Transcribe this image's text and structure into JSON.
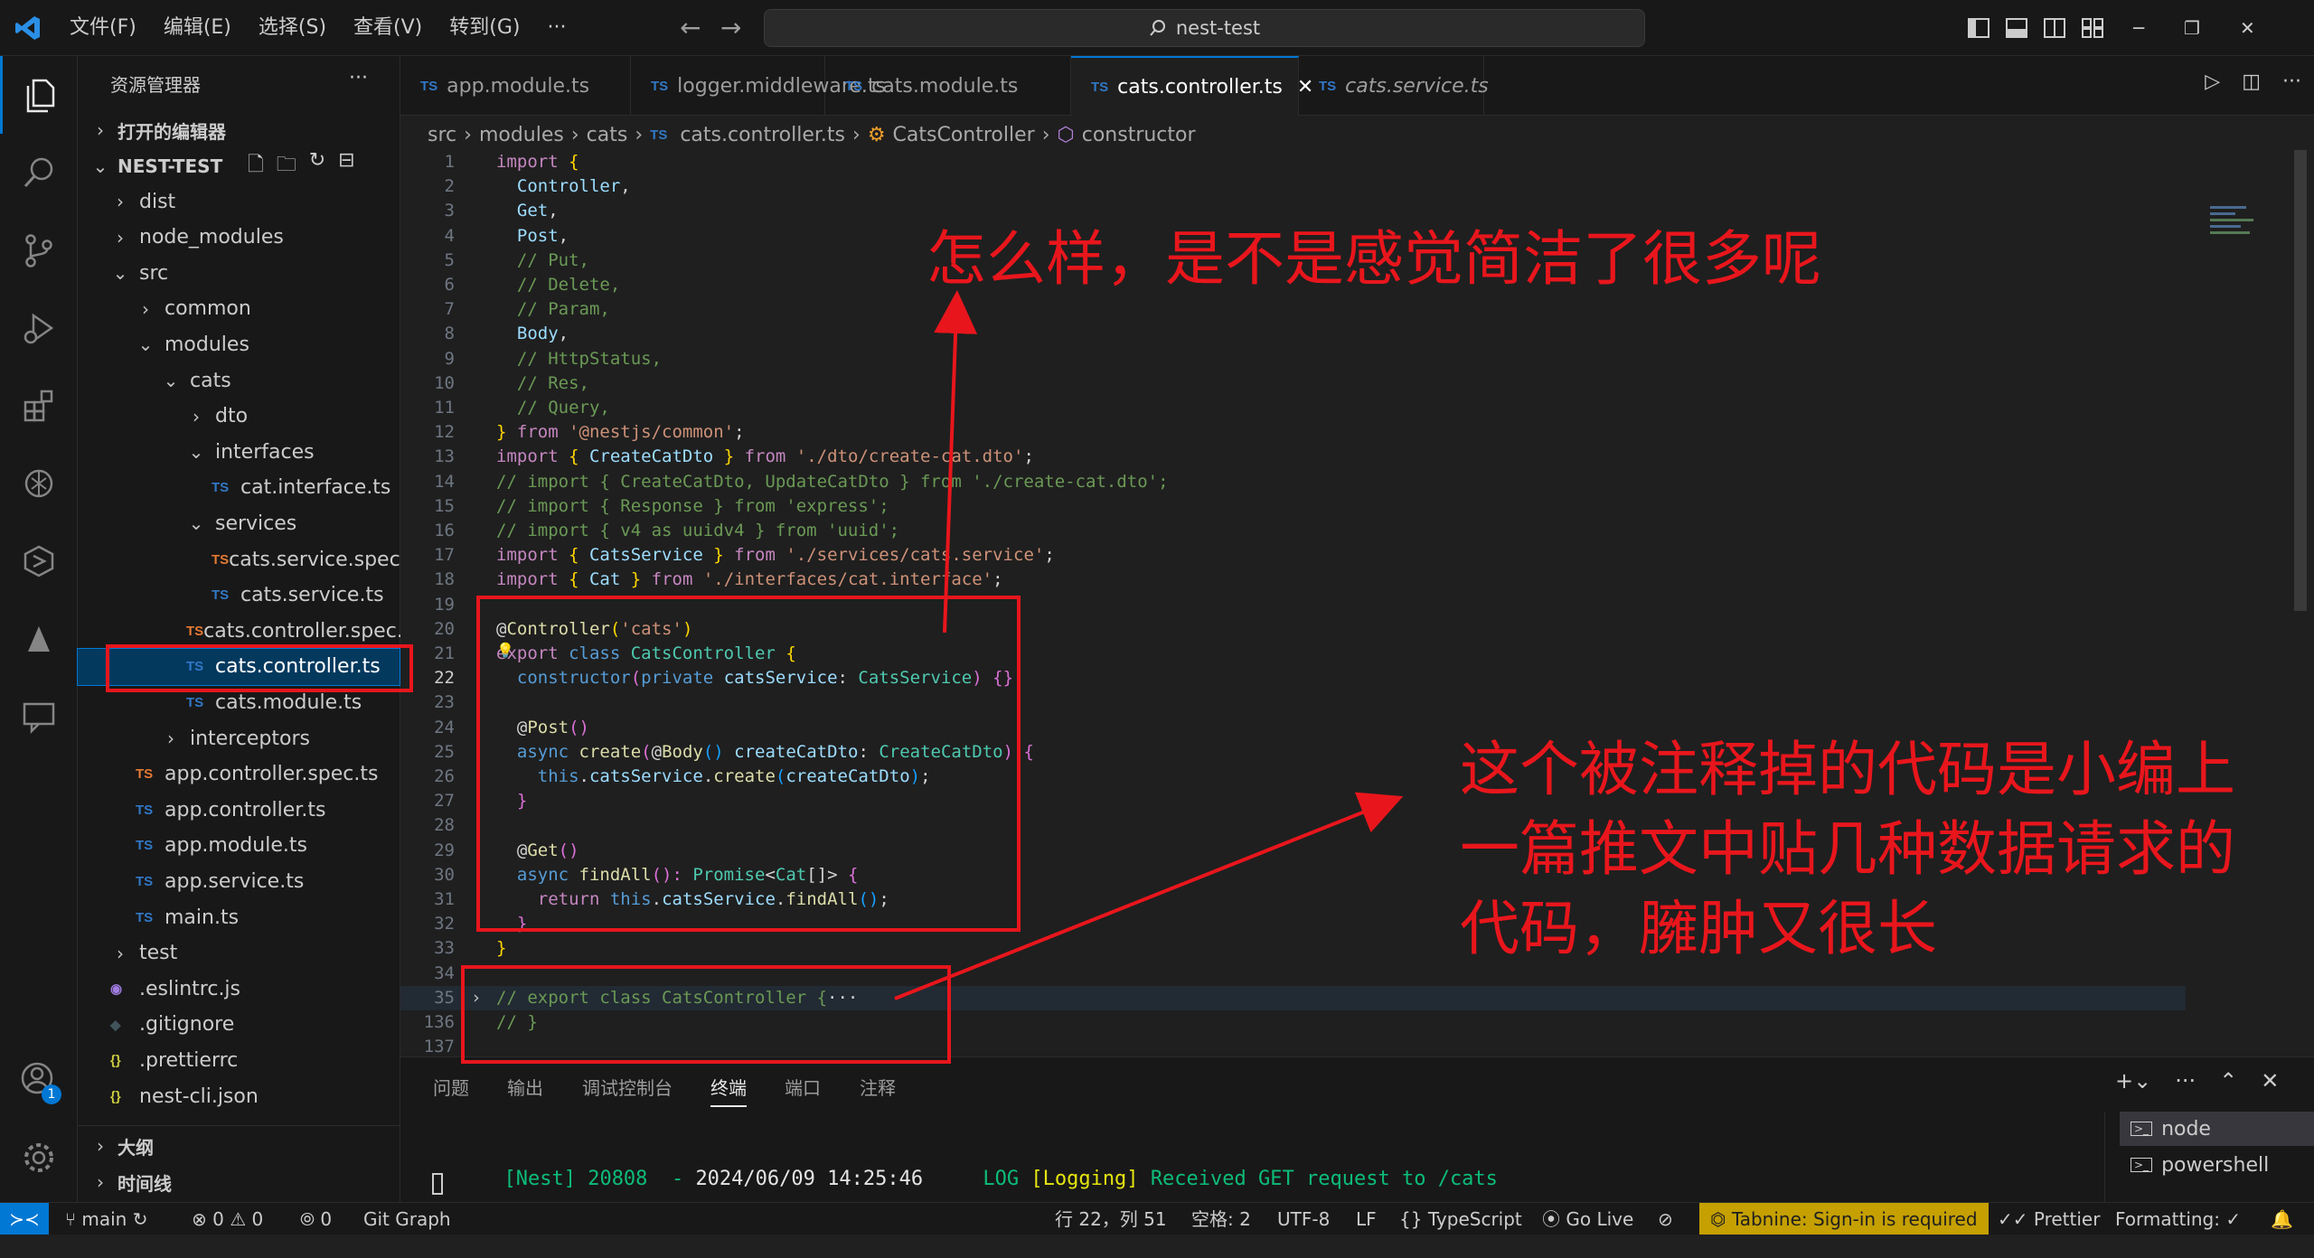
{
  "titlebar": {
    "menu": [
      "文件(F)",
      "编辑(E)",
      "选择(S)",
      "查看(V)",
      "转到(G)",
      "···"
    ],
    "search": "nest-test"
  },
  "sidebar": {
    "title": "资源管理器",
    "more": "···",
    "open_editors": "打开的编辑器",
    "project": "NEST-TEST",
    "tree": [
      {
        "label": "dist",
        "type": "folder",
        "open": false,
        "depth": 0
      },
      {
        "label": "node_modules",
        "type": "folder",
        "open": false,
        "depth": 0
      },
      {
        "label": "src",
        "type": "folder",
        "open": true,
        "depth": 0
      },
      {
        "label": "common",
        "type": "folder",
        "open": false,
        "depth": 1
      },
      {
        "label": "modules",
        "type": "folder",
        "open": true,
        "depth": 1
      },
      {
        "label": "cats",
        "type": "folder",
        "open": true,
        "depth": 2
      },
      {
        "label": "dto",
        "type": "folder",
        "open": false,
        "depth": 3
      },
      {
        "label": "interfaces",
        "type": "folder",
        "open": true,
        "depth": 3
      },
      {
        "label": "cat.interface.ts",
        "type": "ts",
        "depth": 4
      },
      {
        "label": "services",
        "type": "folder",
        "open": true,
        "depth": 3
      },
      {
        "label": "cats.service.spec.ts",
        "type": "spec",
        "depth": 4
      },
      {
        "label": "cats.service.ts",
        "type": "ts",
        "depth": 4
      },
      {
        "label": "cats.controller.spec.ts",
        "type": "spec",
        "depth": 3
      },
      {
        "label": "cats.controller.ts",
        "type": "ts",
        "depth": 3,
        "selected": true
      },
      {
        "label": "cats.module.ts",
        "type": "ts",
        "depth": 3
      },
      {
        "label": "interceptors",
        "type": "folder",
        "open": false,
        "depth": 2
      },
      {
        "label": "app.controller.spec.ts",
        "type": "spec",
        "depth": 1
      },
      {
        "label": "app.controller.ts",
        "type": "ts",
        "depth": 1
      },
      {
        "label": "app.module.ts",
        "type": "ts",
        "depth": 1
      },
      {
        "label": "app.service.ts",
        "type": "ts",
        "depth": 1
      },
      {
        "label": "main.ts",
        "type": "ts",
        "depth": 1
      },
      {
        "label": "test",
        "type": "folder",
        "open": false,
        "depth": 0
      },
      {
        "label": ".eslintrc.js",
        "type": "eslint",
        "depth": 0
      },
      {
        "label": ".gitignore",
        "type": "git",
        "depth": 0
      },
      {
        "label": ".prettierrc",
        "type": "json",
        "depth": 0
      },
      {
        "label": "nest-cli.json",
        "type": "json",
        "depth": 0
      }
    ],
    "outline": "大纲",
    "timeline": "时间线",
    "account_badge": "1"
  },
  "tabs": [
    {
      "label": "app.module.ts",
      "active": false
    },
    {
      "label": "logger.middleware.ts",
      "active": false
    },
    {
      "label": "cats.module.ts",
      "active": false
    },
    {
      "label": "cats.controller.ts",
      "active": true
    },
    {
      "label": "cats.service.ts",
      "active": false,
      "italic": true
    }
  ],
  "breadcrumb": {
    "src": "src",
    "modules": "modules",
    "cats": "cats",
    "file": "cats.controller.ts",
    "class": "CatsController",
    "member": "constructor"
  },
  "code_lines": [
    {
      "n": "1",
      "t": [
        [
          "import",
          "kw2"
        ],
        [
          " {",
          "br"
        ]
      ]
    },
    {
      "n": "2",
      "t": [
        [
          "  Controller",
          "id"
        ],
        [
          ",",
          "pn"
        ]
      ]
    },
    {
      "n": "3",
      "t": [
        [
          "  Get",
          "id"
        ],
        [
          ",",
          "pn"
        ]
      ]
    },
    {
      "n": "4",
      "t": [
        [
          "  Post",
          "id"
        ],
        [
          ",",
          "pn"
        ]
      ]
    },
    {
      "n": "5",
      "t": [
        [
          "  // Put,",
          "cm"
        ]
      ]
    },
    {
      "n": "6",
      "t": [
        [
          "  // Delete,",
          "cm"
        ]
      ]
    },
    {
      "n": "7",
      "t": [
        [
          "  // Param,",
          "cm"
        ]
      ]
    },
    {
      "n": "8",
      "t": [
        [
          "  Body",
          "id"
        ],
        [
          ",",
          "pn"
        ]
      ]
    },
    {
      "n": "9",
      "t": [
        [
          "  // HttpStatus,",
          "cm"
        ]
      ]
    },
    {
      "n": "10",
      "t": [
        [
          "  // Res,",
          "cm"
        ]
      ]
    },
    {
      "n": "11",
      "t": [
        [
          "  // Query,",
          "cm"
        ]
      ]
    },
    {
      "n": "12",
      "t": [
        [
          "}",
          "br"
        ],
        [
          " from ",
          "kw2"
        ],
        [
          "'@nestjs/common'",
          "str"
        ],
        [
          ";",
          "pn"
        ]
      ]
    },
    {
      "n": "13",
      "t": [
        [
          "import",
          "kw2"
        ],
        [
          " { ",
          "br"
        ],
        [
          "CreateCatDto",
          "id"
        ],
        [
          " } ",
          "br"
        ],
        [
          "from ",
          "kw2"
        ],
        [
          "'./dto/create-cat.dto'",
          "str"
        ],
        [
          ";",
          "pn"
        ]
      ]
    },
    {
      "n": "14",
      "t": [
        [
          "// import { CreateCatDto, UpdateCatDto } from './create-cat.dto';",
          "cm"
        ]
      ]
    },
    {
      "n": "15",
      "t": [
        [
          "// import { Response } from 'express';",
          "cm"
        ]
      ]
    },
    {
      "n": "16",
      "t": [
        [
          "// import { v4 as uuidv4 } from 'uuid';",
          "cm"
        ]
      ]
    },
    {
      "n": "17",
      "t": [
        [
          "import",
          "kw2"
        ],
        [
          " { ",
          "br"
        ],
        [
          "CatsService",
          "id"
        ],
        [
          " } ",
          "br"
        ],
        [
          "from ",
          "kw2"
        ],
        [
          "'./services/cats.service'",
          "str"
        ],
        [
          ";",
          "pn"
        ]
      ]
    },
    {
      "n": "18",
      "t": [
        [
          "import",
          "kw2"
        ],
        [
          " { ",
          "br"
        ],
        [
          "Cat",
          "id"
        ],
        [
          " } ",
          "br"
        ],
        [
          "from ",
          "kw2"
        ],
        [
          "'./interfaces/cat.interface'",
          "str"
        ],
        [
          ";",
          "pn"
        ]
      ]
    },
    {
      "n": "19",
      "t": []
    },
    {
      "n": "20",
      "t": [
        [
          "@",
          "pn"
        ],
        [
          "Controller",
          "fn"
        ],
        [
          "(",
          "br"
        ],
        [
          "'cats'",
          "str"
        ],
        [
          ")",
          "br"
        ]
      ]
    },
    {
      "n": "21",
      "t": [
        [
          "export",
          "kw2"
        ],
        [
          " class ",
          "kw"
        ],
        [
          "CatsController",
          "ty"
        ],
        [
          " {",
          "br"
        ]
      ]
    },
    {
      "n": "22",
      "t": [
        [
          "  constructor",
          "kw"
        ],
        [
          "(",
          "br2"
        ],
        [
          "private ",
          "kw"
        ],
        [
          "catsService",
          "id"
        ],
        [
          ": ",
          "pn"
        ],
        [
          "CatsService",
          "ty"
        ],
        [
          ") ",
          "br2"
        ],
        [
          "{}",
          "br2"
        ]
      ]
    },
    {
      "n": "23",
      "t": []
    },
    {
      "n": "24",
      "t": [
        [
          "  @",
          "pn"
        ],
        [
          "Post",
          "fn"
        ],
        [
          "()",
          "br2"
        ]
      ]
    },
    {
      "n": "25",
      "t": [
        [
          "  async ",
          "kw"
        ],
        [
          "create",
          "fn"
        ],
        [
          "(",
          "br2"
        ],
        [
          "@",
          "pn"
        ],
        [
          "Body",
          "fn"
        ],
        [
          "() ",
          "br3"
        ],
        [
          "createCatDto",
          "id"
        ],
        [
          ": ",
          "pn"
        ],
        [
          "CreateCatDto",
          "ty"
        ],
        [
          ") ",
          "br2"
        ],
        [
          "{",
          "br2"
        ]
      ]
    },
    {
      "n": "26",
      "t": [
        [
          "    this",
          "kw"
        ],
        [
          ".",
          "pn"
        ],
        [
          "catsService",
          "id"
        ],
        [
          ".",
          "pn"
        ],
        [
          "create",
          "fn"
        ],
        [
          "(",
          "br3"
        ],
        [
          "createCatDto",
          "id"
        ],
        [
          ")",
          "br3"
        ],
        [
          ";",
          "pn"
        ]
      ]
    },
    {
      "n": "27",
      "t": [
        [
          "  }",
          "br2"
        ]
      ]
    },
    {
      "n": "28",
      "t": []
    },
    {
      "n": "29",
      "t": [
        [
          "  @",
          "pn"
        ],
        [
          "Get",
          "fn"
        ],
        [
          "()",
          "br2"
        ]
      ]
    },
    {
      "n": "30",
      "t": [
        [
          "  async ",
          "kw"
        ],
        [
          "findAll",
          "fn"
        ],
        [
          "(): ",
          "br2"
        ],
        [
          "Promise",
          "ty"
        ],
        [
          "<",
          "pn"
        ],
        [
          "Cat",
          "ty"
        ],
        [
          "[]",
          "pn"
        ],
        [
          "> ",
          "pn"
        ],
        [
          "{",
          "br2"
        ]
      ]
    },
    {
      "n": "31",
      "t": [
        [
          "    return ",
          "kw2"
        ],
        [
          "this",
          "kw"
        ],
        [
          ".",
          "pn"
        ],
        [
          "catsService",
          "id"
        ],
        [
          ".",
          "pn"
        ],
        [
          "findAll",
          "fn"
        ],
        [
          "()",
          "br3"
        ],
        [
          ";",
          "pn"
        ]
      ]
    },
    {
      "n": "32",
      "t": [
        [
          "  }",
          "br2"
        ]
      ]
    },
    {
      "n": "33",
      "t": [
        [
          "}",
          "br"
        ]
      ]
    },
    {
      "n": "34",
      "t": []
    },
    {
      "n": "35",
      "t": [
        [
          "// export class CatsController {",
          "cm"
        ],
        [
          "···",
          "pn"
        ]
      ],
      "fold": true
    },
    {
      "n": "136",
      "t": [
        [
          "// }",
          "cm"
        ]
      ]
    },
    {
      "n": "137",
      "t": []
    }
  ],
  "annotations": {
    "top": "怎么样，是不是感觉简洁了很多呢",
    "right": [
      "这个被注释掉的代码是小编上",
      "一篇推文中贴几种数据请求的",
      "代码，臃肿又很长"
    ]
  },
  "panel": {
    "tabs": [
      "问题",
      "输出",
      "调试控制台",
      "终端",
      "端口",
      "注释"
    ],
    "active_tab": "终端",
    "terminal": {
      "prefix": "[Nest] 20808",
      "dash": "-",
      "time": "2024/06/09 14:25:46",
      "level": "LOG",
      "context": "[Logging]",
      "message": "Received GET request to /cats"
    },
    "terminals": [
      "node",
      "powershell"
    ]
  },
  "statusbar": {
    "branch": "main",
    "errors": "0",
    "warnings": "0",
    "ports": "0",
    "git_graph": "Git Graph",
    "position": "行 22，列 51",
    "spaces": "空格: 2",
    "encoding": "UTF-8",
    "eol": "LF",
    "language": "TypeScript",
    "golive": "Go Live",
    "tabnine": "Tabnine: Sign-in is required",
    "prettier": "Prettier",
    "formatting": "Formatting: ✓"
  },
  "colors": {
    "accent": "#0078d4",
    "annotation_red": "#e8161c",
    "ts_blue": "#3178c6",
    "spec_orange": "#e37933",
    "tabnine_bg": "#c5a000"
  }
}
